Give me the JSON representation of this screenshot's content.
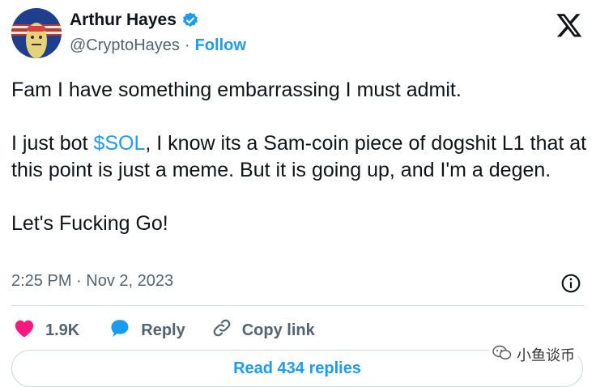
{
  "author": {
    "name": "Arthur Hayes",
    "handle": "@CryptoHayes",
    "separator": "·",
    "follow_label": "Follow",
    "verified": true
  },
  "tweet": {
    "line1": "Fam I have something embarrassing I must admit.",
    "para2_before": "I just bot ",
    "cashtag": "$SOL",
    "para2_after": ", I know its a Sam-coin piece of dogshit L1 that at this point is just a meme. But it is going up, and I'm a degen.",
    "line3": "Let's Fucking Go!"
  },
  "meta": {
    "time": "2:25 PM",
    "separator": "·",
    "date": "Nov 2, 2023"
  },
  "actions": {
    "likes": "1.9K",
    "reply_label": "Reply",
    "copy_label": "Copy link"
  },
  "read_replies": "Read 434 replies",
  "watermark": "小鱼谈币",
  "colors": {
    "accent": "#1d9bf0",
    "heart": "#f91880",
    "text": "#0f1419",
    "muted": "#536471",
    "border": "#cfd9de"
  },
  "icons": [
    "x-logo-icon",
    "verified-badge-icon",
    "info-icon",
    "heart-icon",
    "reply-bubble-icon",
    "link-icon",
    "wechat-icon"
  ]
}
